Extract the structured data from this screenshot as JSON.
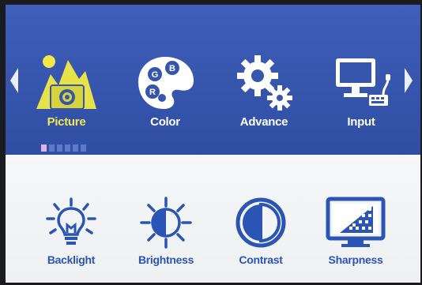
{
  "menu": {
    "tabs": [
      {
        "label": "Picture",
        "icon": "picture-icon",
        "active": true
      },
      {
        "label": "Color",
        "icon": "color-palette-icon",
        "active": false
      },
      {
        "label": "Advance",
        "icon": "gears-icon",
        "active": false
      },
      {
        "label": "Input",
        "icon": "monitor-input-icon",
        "active": false
      }
    ],
    "pager": {
      "count": 6,
      "current": 1
    },
    "palette_letters": {
      "g": "G",
      "b": "B",
      "r": "R"
    }
  },
  "submenu": {
    "items": [
      {
        "label": "Backlight",
        "icon": "backlight-bulb-icon"
      },
      {
        "label": "Brightness",
        "icon": "brightness-sun-icon"
      },
      {
        "label": "Contrast",
        "icon": "contrast-icon"
      },
      {
        "label": "Sharpness",
        "icon": "sharpness-icon"
      }
    ]
  },
  "colors": {
    "top_band": "#3655ad",
    "active_label": "#f3e84a",
    "sub_icon": "#2a55b4"
  }
}
